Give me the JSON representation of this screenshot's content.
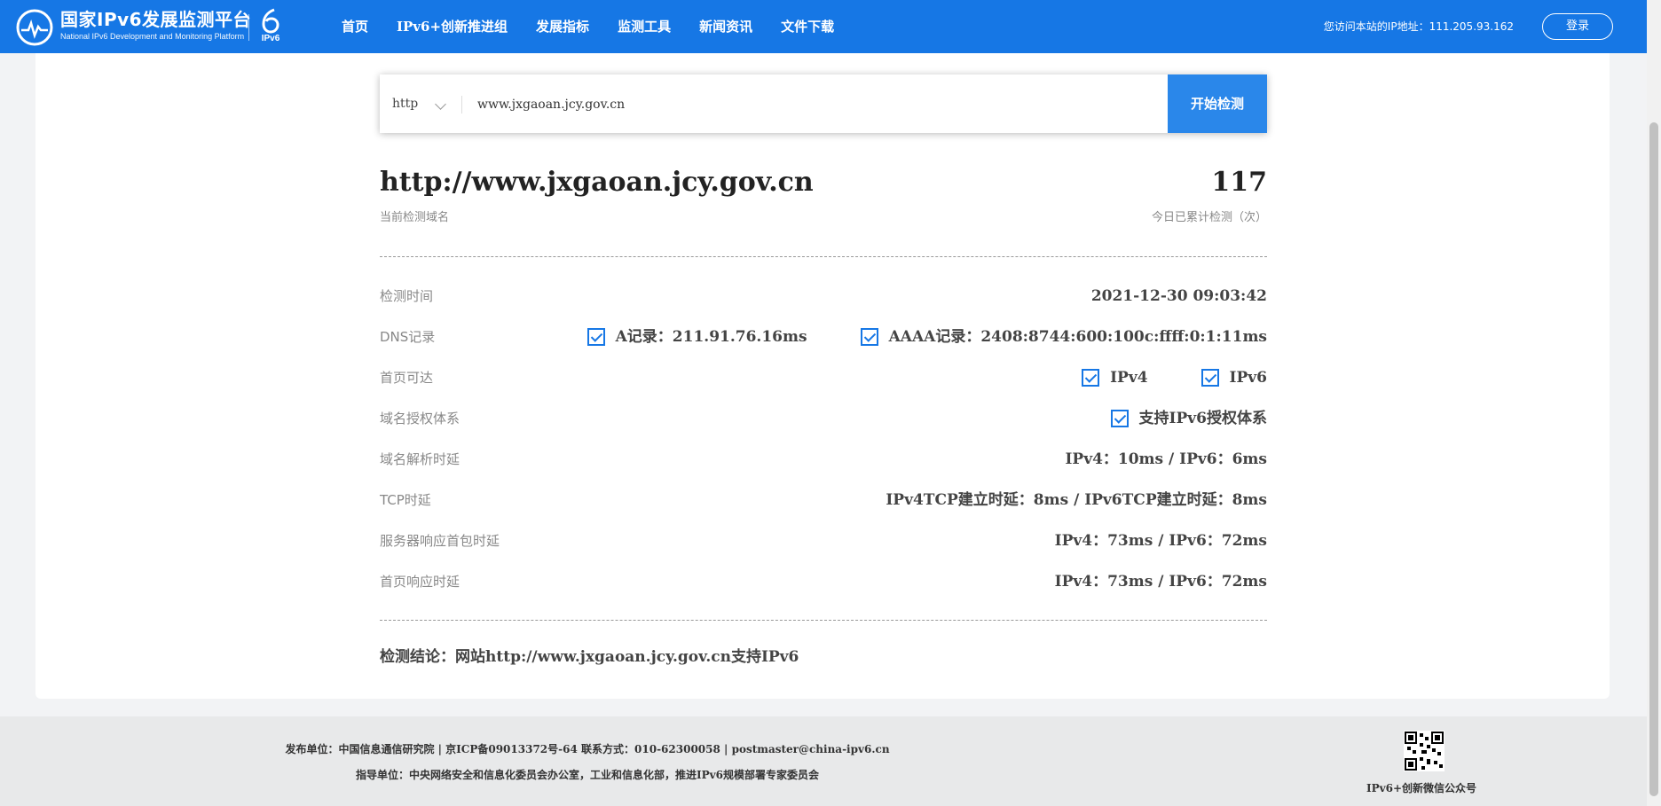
{
  "header": {
    "logo_cn": "国家IPv6发展监测平台",
    "logo_en": "National IPv6 Development and Monitoring Platform",
    "badge": "IPv6",
    "nav": [
      "首页",
      "IPv6+创新推进组",
      "发展指标",
      "监测工具",
      "新闻资讯",
      "文件下载"
    ],
    "visitor_ip": "您访问本站的IP地址：111.205.93.162",
    "login": "登录"
  },
  "search": {
    "protocol": "http",
    "domain_value": "www.jxgaoan.jcy.gov.cn",
    "start_button": "开始检测"
  },
  "summary": {
    "domain": "http://www.jxgaoan.jcy.gov.cn",
    "domain_label": "当前检测域名",
    "count": "117",
    "count_label": "今日已累计检测（次）"
  },
  "results": {
    "check_time_label": "检测时间",
    "check_time": "2021-12-30 09:03:42",
    "dns_label": "DNS记录",
    "dns_a": "A记录：211.91.76.16ms",
    "dns_aaaa": "AAAA记录：2408:8744:600:100c:ffff:0:1:11ms",
    "homepage_label": "首页可达",
    "homepage_ipv4": "IPv4",
    "homepage_ipv6": "IPv6",
    "auth_label": "域名授权体系",
    "auth_value": "支持IPv6授权体系",
    "resolve_label": "域名解析时延",
    "resolve_value": "IPv4：10ms / IPv6：6ms",
    "tcp_label": "TCP时延",
    "tcp_value": "IPv4TCP建立时延：8ms / IPv6TCP建立时延：8ms",
    "server_label": "服务器响应首包时延",
    "server_value": "IPv4：73ms / IPv6：72ms",
    "page_label": "首页响应时延",
    "page_value": "IPv4：73ms / IPv6：72ms",
    "conclusion": "检测结论：网站http://www.jxgaoan.jcy.gov.cn支持IPv6"
  },
  "footer": {
    "line1": "发布单位：中国信息通信研究院 | 京ICP备09013372号-64 联系方式：010-62300058 | postmaster@china-ipv6.cn",
    "line2": "指导单位：中央网络安全和信息化委员会办公室，工业和信息化部，推进IPv6规模部署专家委员会",
    "qr_label": "IPv6+创新微信公众号"
  },
  "colors": {
    "brand": "#1677e5",
    "button": "#2a87ea"
  }
}
